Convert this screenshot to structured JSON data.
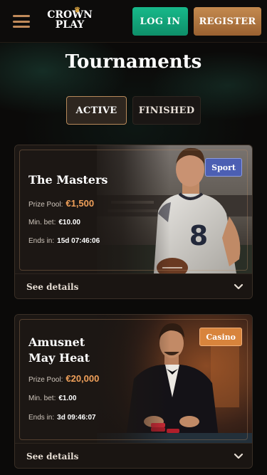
{
  "header": {
    "logo_top": "CROWN",
    "logo_bottom": "PLAY",
    "login_label": "LOG IN",
    "register_label": "REGISTER"
  },
  "page": {
    "title": "Tournaments"
  },
  "tabs": [
    {
      "label": "ACTIVE",
      "selected": true
    },
    {
      "label": "FINISHED",
      "selected": false
    }
  ],
  "tournaments": [
    {
      "title": "The Masters",
      "badge": "Sport",
      "prize_label": "Prize Pool:",
      "prize_value": "€1,500",
      "min_bet_label": "Min. bet:",
      "min_bet_value": "€10.00",
      "ends_label": "Ends in:",
      "ends_value": "15d 07:46:06",
      "details_label": "See details",
      "art_icon": "football-player-illustration"
    },
    {
      "title": "Amusnet May Heat",
      "badge": "Casino",
      "prize_label": "Prize Pool:",
      "prize_value": "€20,000",
      "min_bet_label": "Min. bet:",
      "min_bet_value": "€1.00",
      "ends_label": "Ends in:",
      "ends_value": "3d 09:46:07",
      "details_label": "See details",
      "art_icon": "casino-gentleman-illustration"
    }
  ],
  "colors": {
    "login": "#17b98a",
    "register": "#c48a4f",
    "prize": "#f0a05a",
    "badge_sport": "#4c5fb3",
    "badge_casino": "#d8843c"
  }
}
